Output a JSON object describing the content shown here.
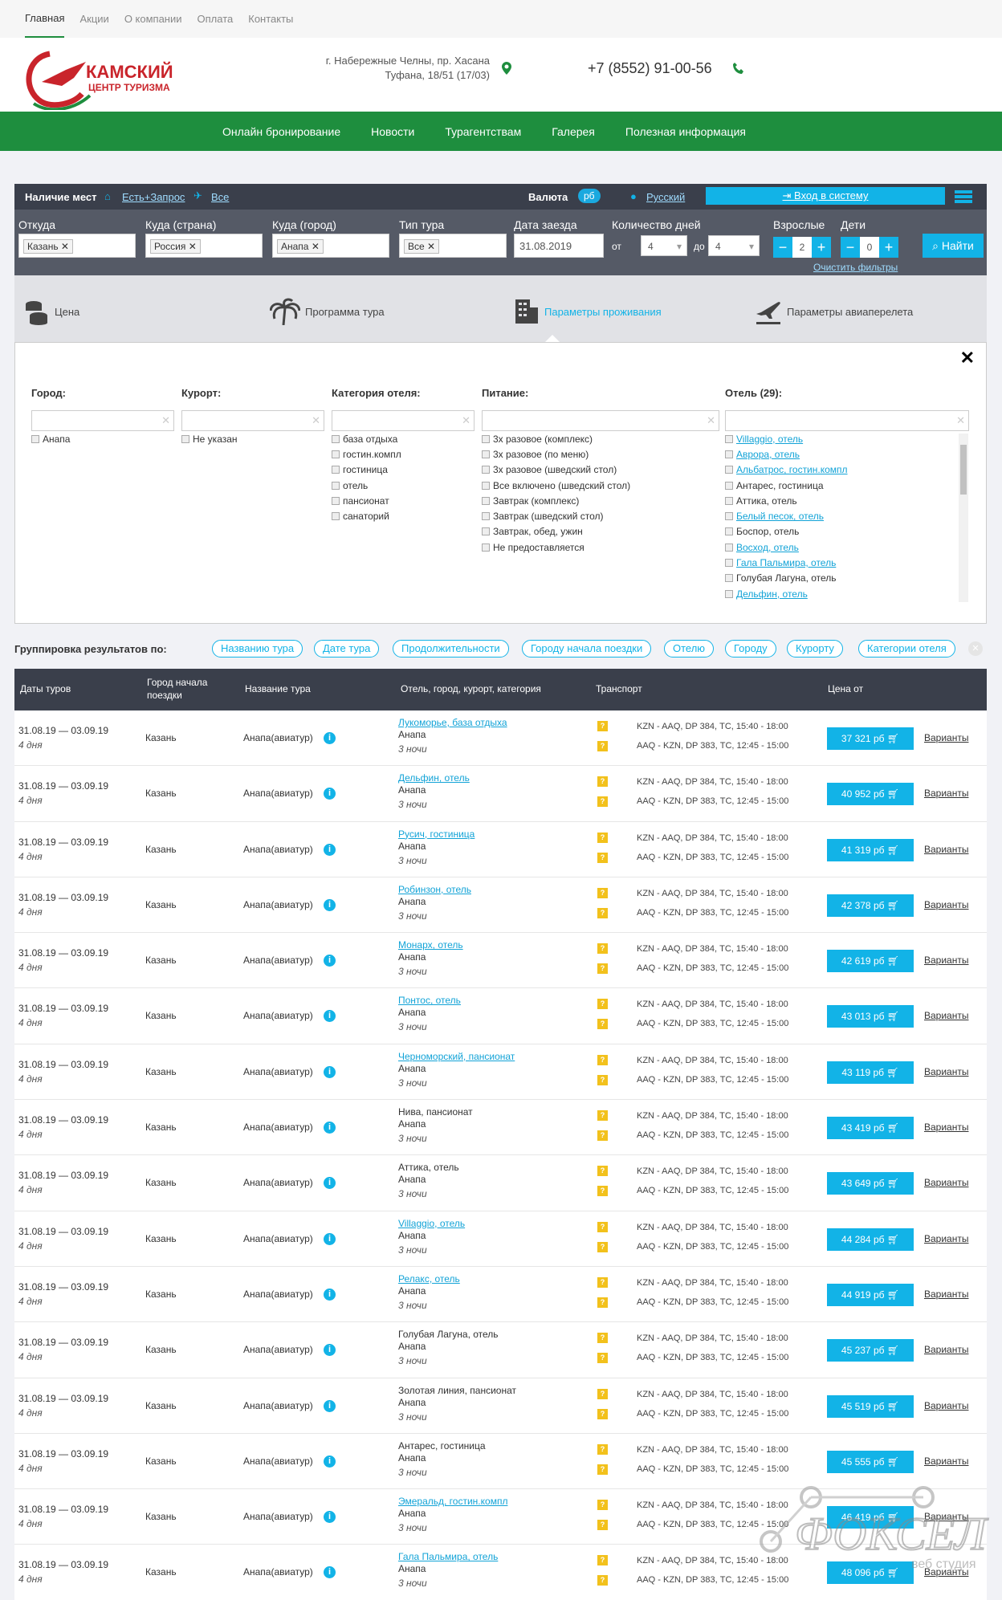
{
  "topnav": [
    "Главная",
    "Акции",
    "О компании",
    "Оплата",
    "Контакты"
  ],
  "logo": {
    "line1": "КАМСКИЙ",
    "line2": "ЦЕНТР ТУРИЗМА"
  },
  "address": {
    "line1": "г. Набережные Челны, пр. Хасана",
    "line2": "Туфана, 18/51 (17/03)"
  },
  "phone": "+7 (8552) 91-00-56",
  "mainnav": [
    "Онлайн бронирование",
    "Новости",
    "Турагентствам",
    "Галерея",
    "Полезная информация"
  ],
  "bar": {
    "availability": "Наличие мест",
    "avail_link": "Есть+Запрос",
    "flight_link": "Все",
    "currency_label": "Валюта",
    "currency": "рб",
    "lang": "Русский",
    "login": "Вход в систему"
  },
  "search": {
    "from_label": "Откуда",
    "from": "Казань",
    "country_label": "Куда (страна)",
    "country": "Россия",
    "city_label": "Куда (город)",
    "city": "Анапа",
    "type_label": "Тип тура",
    "type": "Все",
    "date_label": "Дата заезда",
    "date": "31.08.2019",
    "days_label": "Количество дней",
    "days_from_lbl": "от",
    "days_from": "4",
    "days_to_lbl": "до",
    "days_to": "4",
    "adults_label": "Взрослые",
    "adults": "2",
    "kids_label": "Дети",
    "kids": "0",
    "find": "Найти",
    "clear": "Очистить фильтры"
  },
  "tabs": [
    "Цена",
    "Программа тура",
    "Параметры проживания",
    "Параметры авиаперелета"
  ],
  "filters": {
    "city": {
      "title": "Город:",
      "options": [
        "Анапа"
      ]
    },
    "resort": {
      "title": "Курорт:",
      "options": [
        "Не указан"
      ]
    },
    "category": {
      "title": "Категория отеля:",
      "options": [
        "база отдыха",
        "гостин.компл",
        "гостиница",
        "отель",
        "пансионат",
        "санаторий"
      ]
    },
    "food": {
      "title": "Питание:",
      "options": [
        "3х разовое (комплекс)",
        "3х разовое (по меню)",
        "3х разовое (шведский стол)",
        "Все включено (шведский стол)",
        "Завтрак (комплекс)",
        "Завтрак (шведский стол)",
        "Завтрак, обед, ужин",
        "Не предоставляется"
      ]
    },
    "hotel": {
      "title": "Отель (29):",
      "options": [
        {
          "name": "Villaggio, отель",
          "link": true
        },
        {
          "name": "Аврора, отель",
          "link": true
        },
        {
          "name": "Альбатрос, гостин.компл",
          "link": true
        },
        {
          "name": "Антарес, гостиница",
          "link": false
        },
        {
          "name": "Аттика, отель",
          "link": false
        },
        {
          "name": "Белый песок, отель",
          "link": true
        },
        {
          "name": "Боспор, отель",
          "link": false
        },
        {
          "name": "Восход, отель",
          "link": true
        },
        {
          "name": "Гала Пальмира, отель",
          "link": true
        },
        {
          "name": "Голубая Лагуна, отель",
          "link": false
        },
        {
          "name": "Дельфин, отель",
          "link": true
        }
      ]
    }
  },
  "grouping": {
    "label": "Группировка результатов по:",
    "pills": [
      "Названию тура",
      "Дате тура",
      "Продолжительности",
      "Городу начала поездки",
      "Отелю",
      "Городу",
      "Курорту",
      "Категории отеля"
    ]
  },
  "table": {
    "headers": [
      "Даты туров",
      "Город начала поездки",
      "Название тура",
      "Отель, город, курорт, категория",
      "Транспорт",
      "Цена от"
    ],
    "rows": [
      {
        "dates": "31.08.19 — 03.09.19",
        "days": "4 дня",
        "city": "Казань",
        "tour": "Анапа(авиатур)",
        "hotel": "Лукоморье, база отдыха",
        "link": true,
        "place": "Анапа",
        "nights": "3 ночи",
        "t1": "KZN - AAQ, DP 384, ТС, 15:40 - 18:00",
        "t2": "AAQ - KZN, DP 383, ТС, 12:45 - 15:00",
        "price": "37 321 рб",
        "var": "Варианты"
      },
      {
        "dates": "31.08.19 — 03.09.19",
        "days": "4 дня",
        "city": "Казань",
        "tour": "Анапа(авиатур)",
        "hotel": "Дельфин, отель",
        "link": true,
        "place": "Анапа",
        "nights": "3 ночи",
        "t1": "KZN - AAQ, DP 384, ТС, 15:40 - 18:00",
        "t2": "AAQ - KZN, DP 383, ТС, 12:45 - 15:00",
        "price": "40 952 рб",
        "var": "Варианты"
      },
      {
        "dates": "31.08.19 — 03.09.19",
        "days": "4 дня",
        "city": "Казань",
        "tour": "Анапа(авиатур)",
        "hotel": "Русич, гостиница",
        "link": true,
        "place": "Анапа",
        "nights": "3 ночи",
        "t1": "KZN - AAQ, DP 384, ТС, 15:40 - 18:00",
        "t2": "AAQ - KZN, DP 383, ТС, 12:45 - 15:00",
        "price": "41 319 рб",
        "var": "Варианты"
      },
      {
        "dates": "31.08.19 — 03.09.19",
        "days": "4 дня",
        "city": "Казань",
        "tour": "Анапа(авиатур)",
        "hotel": "Робинзон, отель",
        "link": true,
        "place": "Анапа",
        "nights": "3 ночи",
        "t1": "KZN - AAQ, DP 384, ТС, 15:40 - 18:00",
        "t2": "AAQ - KZN, DP 383, ТС, 12:45 - 15:00",
        "price": "42 378 рб",
        "var": "Варианты"
      },
      {
        "dates": "31.08.19 — 03.09.19",
        "days": "4 дня",
        "city": "Казань",
        "tour": "Анапа(авиатур)",
        "hotel": "Монарх, отель",
        "link": true,
        "place": "Анапа",
        "nights": "3 ночи",
        "t1": "KZN - AAQ, DP 384, ТС, 15:40 - 18:00",
        "t2": "AAQ - KZN, DP 383, ТС, 12:45 - 15:00",
        "price": "42 619 рб",
        "var": "Варианты"
      },
      {
        "dates": "31.08.19 — 03.09.19",
        "days": "4 дня",
        "city": "Казань",
        "tour": "Анапа(авиатур)",
        "hotel": "Понтос, отель",
        "link": true,
        "place": "Анапа",
        "nights": "3 ночи",
        "t1": "KZN - AAQ, DP 384, ТС, 15:40 - 18:00",
        "t2": "AAQ - KZN, DP 383, ТС, 12:45 - 15:00",
        "price": "43 013 рб",
        "var": "Варианты"
      },
      {
        "dates": "31.08.19 — 03.09.19",
        "days": "4 дня",
        "city": "Казань",
        "tour": "Анапа(авиатур)",
        "hotel": "Черноморский, пансионат",
        "link": true,
        "place": "Анапа",
        "nights": "3 ночи",
        "t1": "KZN - AAQ, DP 384, ТС, 15:40 - 18:00",
        "t2": "AAQ - KZN, DP 383, ТС, 12:45 - 15:00",
        "price": "43 119 рб",
        "var": "Варианты"
      },
      {
        "dates": "31.08.19 — 03.09.19",
        "days": "4 дня",
        "city": "Казань",
        "tour": "Анапа(авиатур)",
        "hotel": "Нива, пансионат",
        "link": false,
        "place": "Анапа",
        "nights": "3 ночи",
        "t1": "KZN - AAQ, DP 384, ТС, 15:40 - 18:00",
        "t2": "AAQ - KZN, DP 383, ТС, 12:45 - 15:00",
        "price": "43 419 рб",
        "var": "Варианты"
      },
      {
        "dates": "31.08.19 — 03.09.19",
        "days": "4 дня",
        "city": "Казань",
        "tour": "Анапа(авиатур)",
        "hotel": "Аттика, отель",
        "link": false,
        "place": "Анапа",
        "nights": "3 ночи",
        "t1": "KZN - AAQ, DP 384, ТС, 15:40 - 18:00",
        "t2": "AAQ - KZN, DP 383, ТС, 12:45 - 15:00",
        "price": "43 649 рб",
        "var": "Варианты"
      },
      {
        "dates": "31.08.19 — 03.09.19",
        "days": "4 дня",
        "city": "Казань",
        "tour": "Анапа(авиатур)",
        "hotel": "Villaggio, отель",
        "link": true,
        "place": "Анапа",
        "nights": "3 ночи",
        "t1": "KZN - AAQ, DP 384, ТС, 15:40 - 18:00",
        "t2": "AAQ - KZN, DP 383, ТС, 12:45 - 15:00",
        "price": "44 284 рб",
        "var": "Варианты"
      },
      {
        "dates": "31.08.19 — 03.09.19",
        "days": "4 дня",
        "city": "Казань",
        "tour": "Анапа(авиатур)",
        "hotel": "Релакс, отель",
        "link": true,
        "place": "Анапа",
        "nights": "3 ночи",
        "t1": "KZN - AAQ, DP 384, ТС, 15:40 - 18:00",
        "t2": "AAQ - KZN, DP 383, ТС, 12:45 - 15:00",
        "price": "44 919 рб",
        "var": "Варианты"
      },
      {
        "dates": "31.08.19 — 03.09.19",
        "days": "4 дня",
        "city": "Казань",
        "tour": "Анапа(авиатур)",
        "hotel": "Голубая Лагуна, отель",
        "link": false,
        "place": "Анапа",
        "nights": "3 ночи",
        "t1": "KZN - AAQ, DP 384, ТС, 15:40 - 18:00",
        "t2": "AAQ - KZN, DP 383, ТС, 12:45 - 15:00",
        "price": "45 237 рб",
        "var": "Варианты"
      },
      {
        "dates": "31.08.19 — 03.09.19",
        "days": "4 дня",
        "city": "Казань",
        "tour": "Анапа(авиатур)",
        "hotel": "Золотая линия, пансионат",
        "link": false,
        "place": "Анапа",
        "nights": "3 ночи",
        "t1": "KZN - AAQ, DP 384, ТС, 15:40 - 18:00",
        "t2": "AAQ - KZN, DP 383, ТС, 12:45 - 15:00",
        "price": "45 519 рб",
        "var": "Варианты"
      },
      {
        "dates": "31.08.19 — 03.09.19",
        "days": "4 дня",
        "city": "Казань",
        "tour": "Анапа(авиатур)",
        "hotel": "Антарес, гостиница",
        "link": false,
        "place": "Анапа",
        "nights": "3 ночи",
        "t1": "KZN - AAQ, DP 384, ТС, 15:40 - 18:00",
        "t2": "AAQ - KZN, DP 383, ТС, 12:45 - 15:00",
        "price": "45 555 рб",
        "var": "Варианты"
      },
      {
        "dates": "31.08.19 — 03.09.19",
        "days": "4 дня",
        "city": "Казань",
        "tour": "Анапа(авиатур)",
        "hotel": "Эмеральд, гостин.компл",
        "link": true,
        "place": "Анапа",
        "nights": "3 ночи",
        "t1": "KZN - AAQ, DP 384, ТС, 15:40 - 18:00",
        "t2": "AAQ - KZN, DP 383, ТС, 12:45 - 15:00",
        "price": "46 419 рб",
        "var": "Варианты"
      },
      {
        "dates": "31.08.19 — 03.09.19",
        "days": "4 дня",
        "city": "Казань",
        "tour": "Анапа(авиатур)",
        "hotel": "Гала Пальмира, отель",
        "link": true,
        "place": "Анапа",
        "nights": "3 ночи",
        "t1": "KZN - AAQ, DP 384, ТС, 15:40 - 18:00",
        "t2": "AAQ - KZN, DP 383, ТС, 12:45 - 15:00",
        "price": "48 096 рб",
        "var": "Варианты"
      }
    ]
  },
  "watermark": {
    "line1": "ФОКСЕЛ",
    "line2": "веб студия"
  },
  "colors": {
    "green": "#1e8e3e",
    "accent": "#12b3e7",
    "dark": "#3a3f4b"
  }
}
